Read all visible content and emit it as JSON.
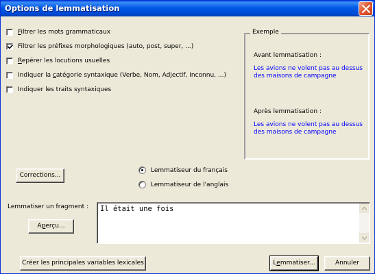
{
  "window": {
    "title": "Options de lemmatisation",
    "colors": {
      "titlebar": "#0054e3",
      "close_button": "#e35a33",
      "face": "#ece9d8",
      "example_text": "#0000ff"
    }
  },
  "options": [
    {
      "mnemonic": "F",
      "rest": "iltrer les mots grammaticaux",
      "checked": false
    },
    {
      "mnemonic": "",
      "rest": "Filtrer les préfixes morphologiques (auto, post, super, ...)",
      "checked": true
    },
    {
      "mnemonic": "R",
      "rest": "epérer les locutions usuelles",
      "checked": false
    },
    {
      "pre": "Indiquer la ",
      "mnemonic": "c",
      "rest": "atégorie syntaxique (Verbe, Nom, Adjectif, Inconnu, ...)",
      "checked": false
    },
    {
      "mnemonic": "",
      "rest": "Indiquer les traits syntaxiques",
      "checked": false
    }
  ],
  "example": {
    "legend": "Exemple",
    "before_label": "Avant lemmatisation :",
    "before_line1": "Les avions ne volent pas au dessus",
    "before_line2": "des maisons de campagne",
    "after_label": "Après lemmatisation :",
    "after_line1": "Les avions ne volent pas au dessus",
    "after_line2": "des maisons de campagne"
  },
  "corrections_button": "Corrections...",
  "lemmatizer": {
    "options": [
      {
        "label": "Lemmatiseur du français",
        "selected": true
      },
      {
        "label": "Lemmatiseur de l'anglais",
        "selected": false
      }
    ]
  },
  "fragment": {
    "label": "Lemmatiser un fragment :",
    "preview_mnemonic": "p",
    "preview_pre": "A",
    "preview_rest": "erçu...",
    "text": "Il était une fois"
  },
  "footer": {
    "create_variables": "Créer les principales variables lexicales",
    "lemmatize_pre": "L",
    "lemmatize_mnemonic": "e",
    "lemmatize_rest": "mmatiser...",
    "cancel": "Annuler"
  }
}
